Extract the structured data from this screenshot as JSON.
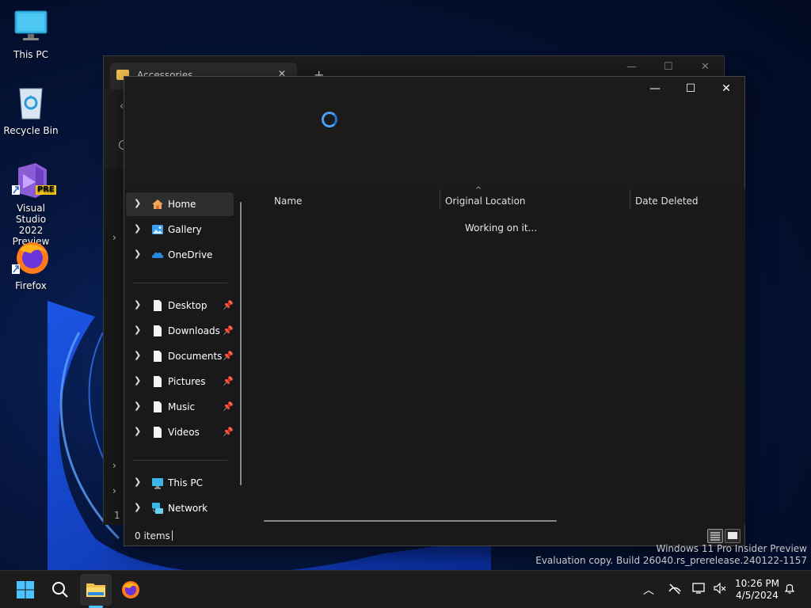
{
  "desktop": {
    "icons": [
      {
        "label": "This PC"
      },
      {
        "label": "Recycle Bin"
      },
      {
        "label_line1": "Visual Studio",
        "label_line2": "2022 Preview",
        "badge": "PRE"
      },
      {
        "label": "Firefox"
      }
    ]
  },
  "background_window": {
    "tab_title": "Accessories",
    "tab_close": "✕",
    "new_tab": "+",
    "controls": {
      "minimize": "—",
      "maximize": "☐",
      "close": "✕"
    },
    "footer_text": "1 i"
  },
  "window": {
    "controls": {
      "minimize": "—",
      "maximize": "☐",
      "close": "✕"
    },
    "nav": {
      "items": [
        {
          "label": "Home",
          "icon": "home-icon",
          "selected": true
        },
        {
          "label": "Gallery",
          "icon": "gallery-icon"
        },
        {
          "label": "OneDrive",
          "icon": "onedrive-icon"
        }
      ],
      "quick_access": [
        {
          "label": "Desktop",
          "icon": "file-icon"
        },
        {
          "label": "Downloads",
          "icon": "file-icon"
        },
        {
          "label": "Documents",
          "icon": "file-icon"
        },
        {
          "label": "Pictures",
          "icon": "file-icon"
        },
        {
          "label": "Music",
          "icon": "file-icon"
        },
        {
          "label": "Videos",
          "icon": "file-icon"
        }
      ],
      "locations": [
        {
          "label": "This PC",
          "icon": "monitor-icon"
        },
        {
          "label": "Network",
          "icon": "network-icon"
        }
      ]
    },
    "columns": {
      "name": "Name",
      "original_location": "Original Location",
      "date_deleted": "Date Deleted"
    },
    "status_message": "Working on it...",
    "status_bar": {
      "items": "0 items"
    }
  },
  "watermark": {
    "line1": "Windows 11 Pro Insider Preview",
    "line2": "Evaluation copy. Build 26040.rs_prerelease.240122-1157"
  },
  "taskbar": {
    "clock": {
      "time": "10:26 PM",
      "date": "4/5/2024"
    },
    "accent_color": "#4cc2ff"
  }
}
